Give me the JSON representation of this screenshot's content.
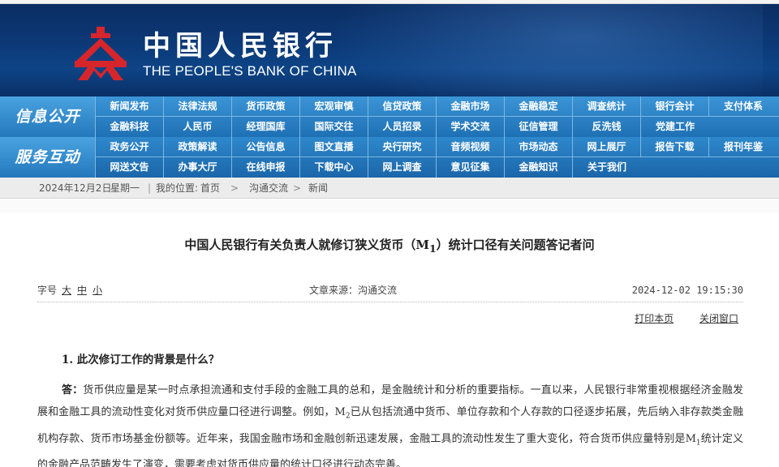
{
  "site": {
    "name_cn": "中国人民银行",
    "name_en": "THE PEOPLE'S BANK OF CHINA"
  },
  "nav": {
    "groups": [
      {
        "label": "信息公开",
        "row1": [
          "新闻发布",
          "法律法规",
          "货币政策",
          "宏观审慎",
          "信贷政策",
          "金融市场",
          "金融稳定",
          "调查统计",
          "银行会计",
          "支付体系"
        ],
        "row2": [
          "金融科技",
          "人民币",
          "经理国库",
          "国际交往",
          "人员招录",
          "学术交流",
          "征信管理",
          "反洗钱",
          "党建工作"
        ]
      },
      {
        "label": "服务互动",
        "row1": [
          "政务公开",
          "政策解读",
          "公告信息",
          "图文直播",
          "央行研究",
          "音频视频",
          "市场动态",
          "网上展厅",
          "报告下载",
          "报刊年鉴"
        ],
        "row2": [
          "网送文告",
          "办事大厅",
          "在线申报",
          "下载中心",
          "网上调查",
          "意见征集",
          "金融知识",
          "关于我们"
        ]
      }
    ]
  },
  "breadcrumb": {
    "date": "2024年12月2日",
    "weekday": "星期一",
    "location_label": "我的位置:",
    "items": [
      "首页",
      "沟通交流",
      "新闻"
    ],
    "separator": "|"
  },
  "article": {
    "title_pre": "中国人民银行有关负责人就修订狭义货币（M",
    "title_sub": "1",
    "title_post": "）统计口径有关问题答记者问",
    "font_size_label": "字号",
    "font_sizes": [
      "大",
      "中",
      "小"
    ],
    "source_label": "文章来源：",
    "source": "沟通交流",
    "timestamp": "2024-12-02 19:15:30",
    "print_label": "打印本页",
    "close_label": "关闭窗口",
    "question1": "1. 此次修订工作的背景是什么？",
    "answer_label": "答：",
    "para_a": "货币供应量是某一时点承担流通和支付手段的金融工具的总和，是金融统计和分析的重要指标。一直以来，人民银行非常重视根据经济金融发展和金融工具的流动性变化对货币供应量口径进行调整。例如，M",
    "sub_2": "2",
    "para_b": "已从包括流通中货币、单位存款和个人存款的口径逐步拓展，先后纳入非存款类金融机构存款、货币市场基金份额等。近年来，我国金融市场和金融创新迅速发展，金融工具的流动性发生了重大变化，符合货币供应量特别是M",
    "sub_1": "1",
    "para_c": "统计定义的金融产品范畴发生了演变，需要考虑对货币供应量的统计口径进行动态完善。"
  },
  "colors": {
    "banner": "#0c3a78",
    "nav": "#1e70b4",
    "logo_red": "#d7262b"
  }
}
